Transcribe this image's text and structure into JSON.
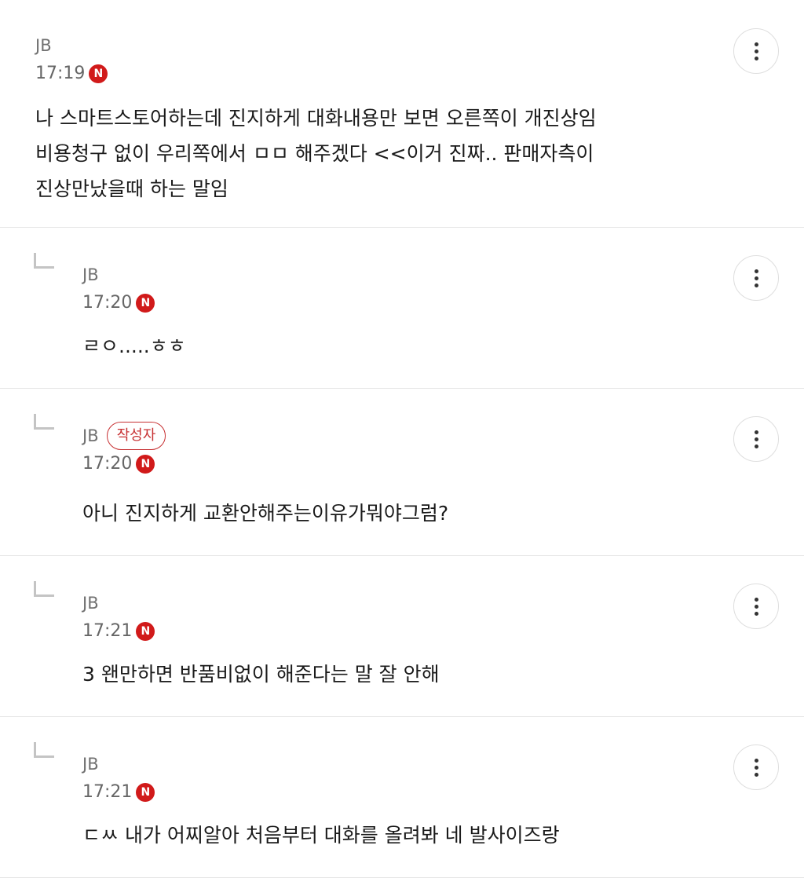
{
  "comments": [
    {
      "author": "JB",
      "time": "17:19",
      "badge_icon": "N",
      "is_reply": false,
      "writer_badge": "",
      "text": "나 스마트스토어하는데 진지하게 대화내용만 보면 오른쪽이 개진상임\n비용청구 없이 우리쪽에서 ㅁㅁ 해주겠다 <<이거 진짜.. 판매자측이\n진상만났을때 하는 말임"
    },
    {
      "author": "JB",
      "time": "17:20",
      "badge_icon": "N",
      "is_reply": true,
      "writer_badge": "",
      "text": "ㄹㅇ.....ㅎㅎ"
    },
    {
      "author": "JB",
      "time": "17:20",
      "badge_icon": "N",
      "is_reply": true,
      "writer_badge": "작성자",
      "text": "아니 진지하게 교환안해주는이유가뭐야그럼?"
    },
    {
      "author": "JB",
      "time": "17:21",
      "badge_icon": "N",
      "is_reply": true,
      "writer_badge": "",
      "text": "3 왠만하면 반품비없이 해준다는 말 잘 안해"
    },
    {
      "author": "JB",
      "time": "17:21",
      "badge_icon": "N",
      "is_reply": true,
      "writer_badge": "",
      "text": "ㄷㅆ 내가 어찌알아 처음부터 대화를 올려봐 네 발사이즈랑"
    }
  ],
  "icons": {
    "more": "more-vertical-icon",
    "reply": "reply-arrow-icon",
    "naver": "naver-n-icon"
  },
  "colors": {
    "accent": "#d11a1a",
    "writer_badge": "#c73032",
    "meta_text": "#707070",
    "divider": "#e6e6e6"
  }
}
